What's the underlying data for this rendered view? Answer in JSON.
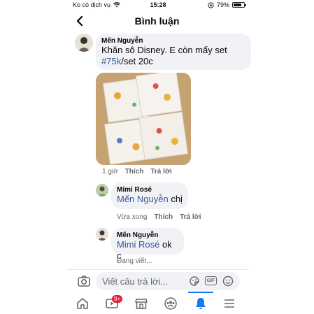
{
  "status_bar": {
    "carrier": "Ko có dịch vụ",
    "time": "15:28",
    "battery": "79%",
    "battery_level": 0.79
  },
  "header": {
    "title": "Bình luận"
  },
  "comments": [
    {
      "author": "Mến Nguyễn",
      "line1": "Khăn sô Disney. E còn mấy set",
      "hashtag": "#75k",
      "line2_rest": "/set 20c",
      "time": "1 giờ",
      "like": "Thích",
      "reply": "Trả lời"
    },
    {
      "author": "Mimi Rosé",
      "mention": "Mến Nguyễn",
      "text": " chị",
      "time": "Vừa xong",
      "like": "Thích",
      "reply": "Trả lời"
    },
    {
      "author": "Mến Nguyễn",
      "mention": "Mimi Rosé",
      "text": " ok c",
      "typing": "Đang viết..."
    }
  ],
  "composer": {
    "placeholder": "Viết câu trả lời...",
    "gif": "GIF"
  },
  "tabbar": {
    "watch_badge": "9+"
  },
  "colors": {
    "link": "#385898",
    "active": "#1877f2",
    "badge": "#e41e3f",
    "bubble": "#f0f2f5"
  }
}
